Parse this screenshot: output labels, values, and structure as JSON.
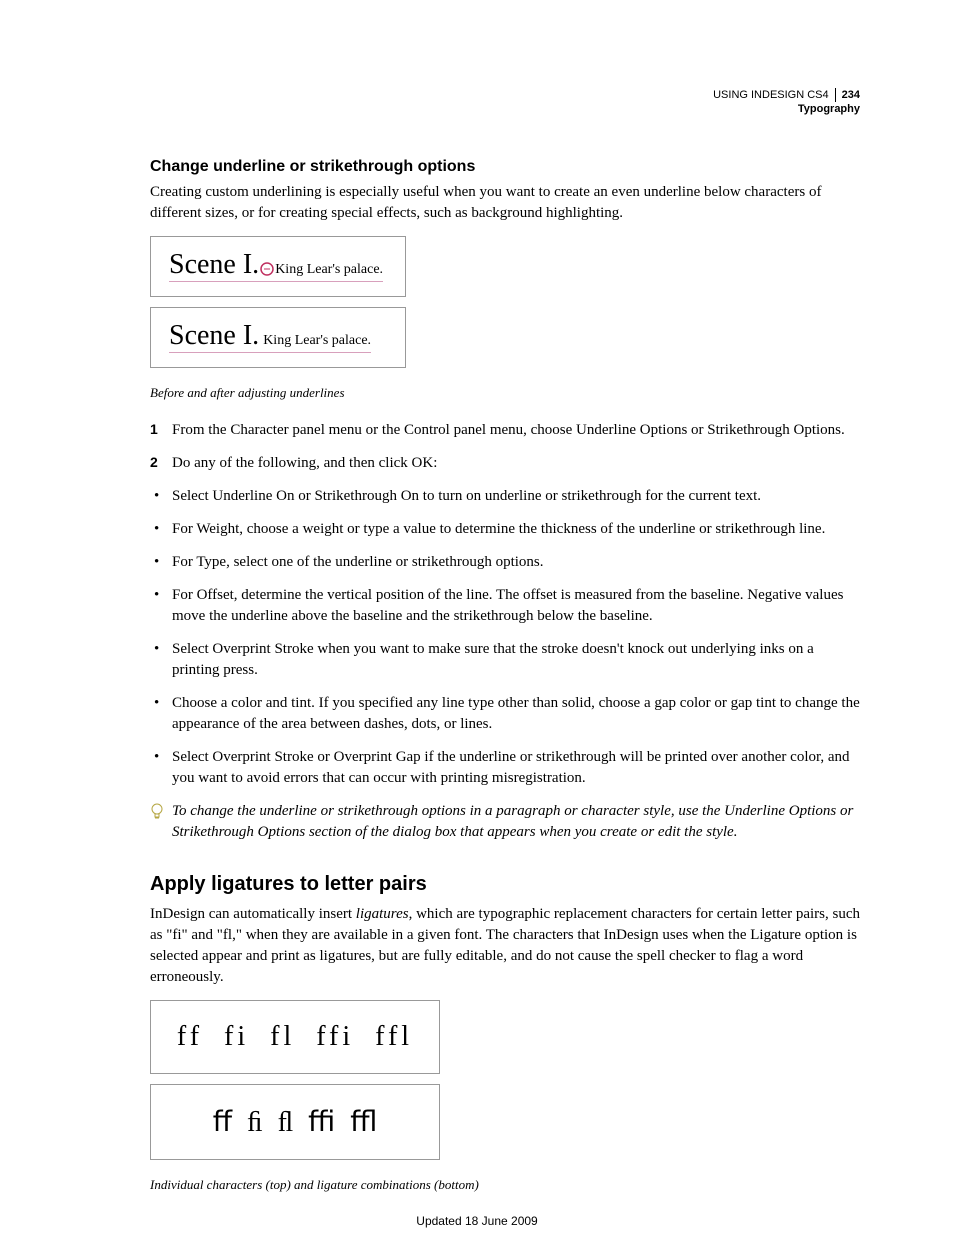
{
  "header": {
    "product": "USING INDESIGN CS4",
    "page_number": "234",
    "section": "Typography"
  },
  "section1": {
    "heading": "Change underline or strikethrough options",
    "intro": "Creating custom underlining is especially useful when you want to create an even underline below characters of different sizes, or for creating special effects, such as background highlighting.",
    "figure": {
      "scene_big": "Scene I.",
      "scene_small": "King Lear's palace.",
      "scene_big2": "Scene I.",
      "scene_small2": "King Lear's palace.",
      "caption": "Before and after adjusting underlines"
    },
    "steps": [
      "From the Character panel menu or the Control panel menu, choose Underline Options or Strikethrough Options.",
      "Do any of the following, and then click OK:"
    ],
    "bullets": [
      "Select Underline On or Strikethrough On to turn on underline or strikethrough for the current text.",
      "For Weight, choose a weight or type a value to determine the thickness of the underline or strikethrough line.",
      "For Type, select one of the underline or strikethrough options.",
      "For Offset, determine the vertical position of the line. The offset is measured from the baseline. Negative values move the underline above the baseline and the strikethrough below the baseline.",
      "Select Overprint Stroke when you want to make sure that the stroke doesn't knock out underlying inks on a printing press.",
      "Choose a color and tint. If you specified any line type other than solid, choose a gap color or gap tint to change the appearance of the area between dashes, dots, or lines.",
      "Select Overprint Stroke or Overprint Gap if the underline or strikethrough will be printed over another color, and you want to avoid errors that can occur with printing misregistration."
    ],
    "tip": "To change the underline or strikethrough options in a paragraph or character style, use the Underline Options or Strikethrough Options section of the dialog box that appears when you create or edit the style."
  },
  "section2": {
    "heading": "Apply ligatures to letter pairs",
    "intro_prefix": "InDesign can automatically insert ",
    "intro_italic": "ligatures",
    "intro_suffix": ", which are typographic replacement characters for certain letter pairs, such as \"fi\" and \"fl,\" when they are available in a given font. The characters that InDesign uses when the Ligature option is selected appear and print as ligatures, but are fully editable, and do not cause the spell checker to flag a word erroneously.",
    "figure": {
      "line1": "ff fi fl ffi ffl",
      "line2": "ﬀ ﬁ ﬂ ﬃ ﬄ",
      "caption": "Individual characters (top) and ligature combinations (bottom)"
    }
  },
  "footer": {
    "updated": "Updated 18 June 2009"
  }
}
